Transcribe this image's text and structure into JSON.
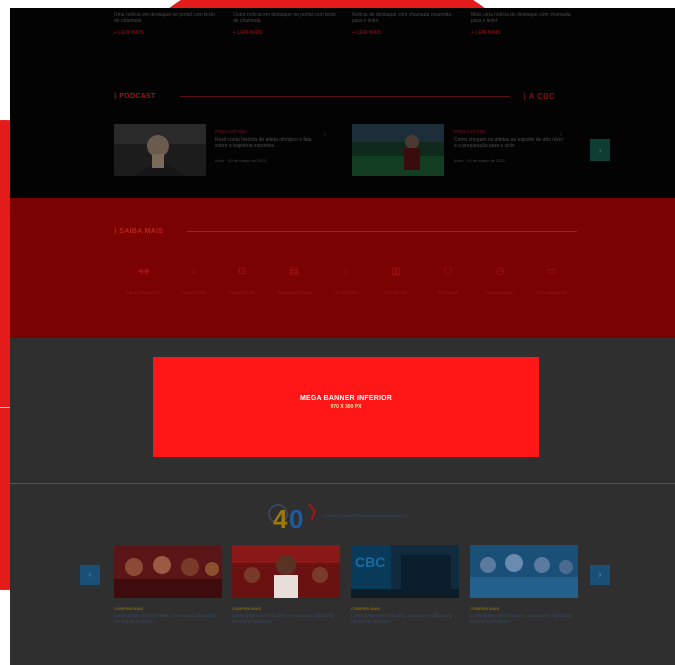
{
  "top_news": [
    {
      "text": "Uma notícia em destaque no portal com texto de chamada",
      "tag": "+ LEIA MAIS"
    },
    {
      "text": "Outra notícia em destaque no portal com texto de chamada",
      "tag": "+ LEIA MAIS"
    },
    {
      "text": "Notícia de destaque com chamada resumida para o leitor",
      "tag": "+ LEIA MAIS"
    },
    {
      "text": "Mais uma notícia de destaque com chamada para o leitor",
      "tag": "+ LEIA MAIS"
    }
  ],
  "podcast": {
    "title": "PODCAST",
    "right_title": "A CBC",
    "items": [
      {
        "category": "PODCAST CBC",
        "title": "Rosil conta história de atleta olímpico e fala sobre a trajetória esportiva",
        "meta": "Autor · 00 de março de 2022"
      },
      {
        "category": "PODCAST CBC",
        "title": "Como chegam os atletas ao esporte de alto nível e a preparação para o ciclo",
        "meta": "Autor · 00 de março de 2022"
      }
    ],
    "next_icon": "chevron-right"
  },
  "services": {
    "title": "SAIBA MAIS",
    "items": [
      {
        "label": "FALE CONOSCO",
        "icon": "◂◈"
      },
      {
        "label": "OUVIDORIA",
        "icon": "○"
      },
      {
        "label": "PARCEIROS",
        "icon": "⊡"
      },
      {
        "label": "TRANSPARÊNCIA",
        "icon": "▤"
      },
      {
        "label": "LICITAÇÕES",
        "icon": "⌂"
      },
      {
        "label": "ESTATUTO",
        "icon": "▥"
      },
      {
        "label": "NOTÍCIAS",
        "icon": "☐"
      },
      {
        "label": "CALENDÁRIO",
        "icon": "◷"
      },
      {
        "label": "DOCUMENTOS",
        "icon": "▭"
      }
    ]
  },
  "banner": {
    "title": "MEGA BANNER INFERIOR",
    "size": "970 X 300 PX"
  },
  "cbc40": {
    "logo_text": "40",
    "caption": "CONHEÇA A HISTÓRIA DA CBC EM 40 ANOS"
  },
  "cards": [
    {
      "category": "CONFIRA MAIS",
      "title": "Lorem ipsum dolor sit amet, consectetur adipiscing elit sed do eiusmod"
    },
    {
      "category": "CONFIRA MAIS",
      "title": "Lorem ipsum dolor sit amet, consectetur adipiscing elit sed do eiusmod"
    },
    {
      "category": "CONFIRA MAIS",
      "title": "Lorem ipsum dolor sit amet, consectetur adipiscing elit sed do eiusmod"
    },
    {
      "category": "CONFIRA MAIS",
      "title": "Lorem ipsum dolor sit amet, consectetur adipiscing elit sed do eiusmod"
    }
  ],
  "colors": {
    "accent_red": "#e31b1b",
    "banner_red": "#ff1717",
    "service_red": "#7a0202"
  }
}
